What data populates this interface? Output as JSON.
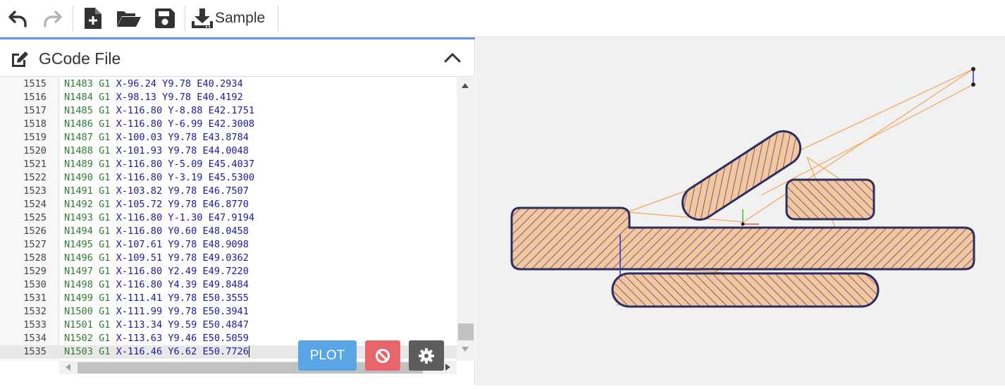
{
  "toolbar": {
    "buttons": [
      {
        "name": "undo-button",
        "icon": "undo-icon",
        "enabled": true
      },
      {
        "name": "redo-button",
        "icon": "redo-icon",
        "enabled": false
      },
      {
        "name": "new-file-button",
        "icon": "new-file-icon",
        "enabled": true
      },
      {
        "name": "open-folder-button",
        "icon": "folder-open-icon",
        "enabled": true
      },
      {
        "name": "save-button",
        "icon": "save-icon",
        "enabled": true
      },
      {
        "name": "sample-button",
        "icon": "download-icon",
        "enabled": true
      }
    ],
    "sample_label": "Sample"
  },
  "panel": {
    "title": "GCode File",
    "icon": "edit-icon",
    "collapse_icon": "chevron-up-icon"
  },
  "editor": {
    "lines": [
      {
        "num": "1515",
        "n": "N1483",
        "g": "G1",
        "x": "X-96.24",
        "y": "Y9.78",
        "e": "E40.2934"
      },
      {
        "num": "1516",
        "n": "N1484",
        "g": "G1",
        "x": "X-98.13",
        "y": "Y9.78",
        "e": "E40.4192"
      },
      {
        "num": "1517",
        "n": "N1485",
        "g": "G1",
        "x": "X-116.80",
        "y": "Y-8.88",
        "e": "E42.1751"
      },
      {
        "num": "1518",
        "n": "N1486",
        "g": "G1",
        "x": "X-116.80",
        "y": "Y-6.99",
        "e": "E42.3008"
      },
      {
        "num": "1519",
        "n": "N1487",
        "g": "G1",
        "x": "X-100.03",
        "y": "Y9.78",
        "e": "E43.8784"
      },
      {
        "num": "1520",
        "n": "N1488",
        "g": "G1",
        "x": "X-101.93",
        "y": "Y9.78",
        "e": "E44.0048"
      },
      {
        "num": "1521",
        "n": "N1489",
        "g": "G1",
        "x": "X-116.80",
        "y": "Y-5.09",
        "e": "E45.4037"
      },
      {
        "num": "1522",
        "n": "N1490",
        "g": "G1",
        "x": "X-116.80",
        "y": "Y-3.19",
        "e": "E45.5300"
      },
      {
        "num": "1523",
        "n": "N1491",
        "g": "G1",
        "x": "X-103.82",
        "y": "Y9.78",
        "e": "E46.7507"
      },
      {
        "num": "1524",
        "n": "N1492",
        "g": "G1",
        "x": "X-105.72",
        "y": "Y9.78",
        "e": "E46.8770"
      },
      {
        "num": "1525",
        "n": "N1493",
        "g": "G1",
        "x": "X-116.80",
        "y": "Y-1.30",
        "e": "E47.9194"
      },
      {
        "num": "1526",
        "n": "N1494",
        "g": "G1",
        "x": "X-116.80",
        "y": "Y0.60",
        "e": "E48.0458"
      },
      {
        "num": "1527",
        "n": "N1495",
        "g": "G1",
        "x": "X-107.61",
        "y": "Y9.78",
        "e": "E48.9098"
      },
      {
        "num": "1528",
        "n": "N1496",
        "g": "G1",
        "x": "X-109.51",
        "y": "Y9.78",
        "e": "E49.0362"
      },
      {
        "num": "1529",
        "n": "N1497",
        "g": "G1",
        "x": "X-116.80",
        "y": "Y2.49",
        "e": "E49.7220"
      },
      {
        "num": "1530",
        "n": "N1498",
        "g": "G1",
        "x": "X-116.80",
        "y": "Y4.39",
        "e": "E49.8484"
      },
      {
        "num": "1531",
        "n": "N1499",
        "g": "G1",
        "x": "X-111.41",
        "y": "Y9.78",
        "e": "E50.3555"
      },
      {
        "num": "1532",
        "n": "N1500",
        "g": "G1",
        "x": "X-111.99",
        "y": "Y9.78",
        "e": "E50.3941"
      },
      {
        "num": "1533",
        "n": "N1501",
        "g": "G1",
        "x": "X-113.34",
        "y": "Y9.59",
        "e": "E50.4847"
      },
      {
        "num": "1534",
        "n": "N1502",
        "g": "G1",
        "x": "X-113.63",
        "y": "Y9.46",
        "e": "E50.5059"
      },
      {
        "num": "1535",
        "n": "N1503",
        "g": "G1",
        "x": "X-116.46",
        "y": "Y6.62",
        "e": "E50.7726"
      }
    ],
    "active_line": "1535"
  },
  "actions": {
    "plot_label": "PLOT",
    "stop_icon": "ban-icon",
    "settings_icon": "gear-icon"
  },
  "viewport": {
    "toolpath_icon": "toolpath-plot",
    "colors": {
      "background": "#f1f1f1",
      "outline": "#2b2b66",
      "fill": "#f4c89a",
      "travel": "#f2a04a",
      "hatch": "#3a3a9a"
    }
  }
}
